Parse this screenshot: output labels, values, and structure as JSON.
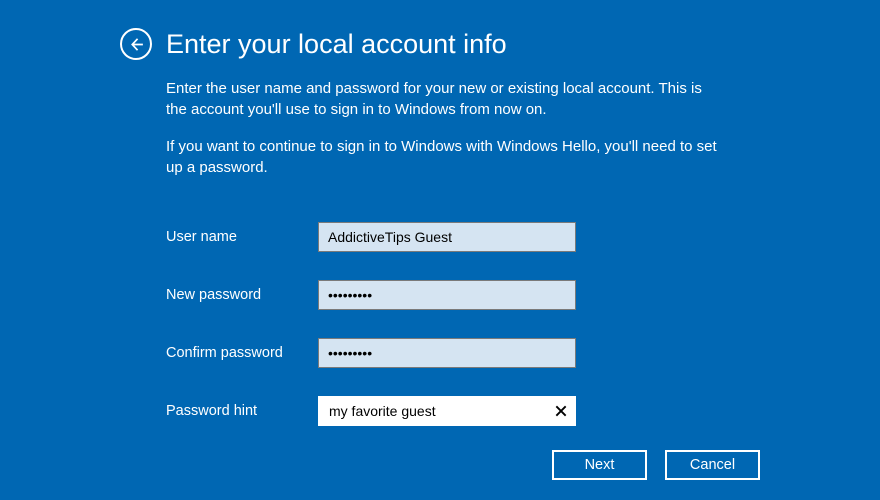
{
  "header": {
    "title": "Enter your local account info"
  },
  "description": {
    "p1": "Enter the user name and password for your new or existing local account. This is the account you'll use to sign in to Windows from now on.",
    "p2": "If you want to continue to sign in to Windows with Windows Hello, you'll need to set up a password."
  },
  "form": {
    "username": {
      "label": "User name",
      "value": "AddictiveTips Guest"
    },
    "newpassword": {
      "label": "New password",
      "value": "•••••••••"
    },
    "confirmpassword": {
      "label": "Confirm password",
      "value": "•••••••••"
    },
    "hint": {
      "label": "Password hint",
      "value": "my favorite guest"
    }
  },
  "buttons": {
    "next": "Next",
    "cancel": "Cancel"
  }
}
